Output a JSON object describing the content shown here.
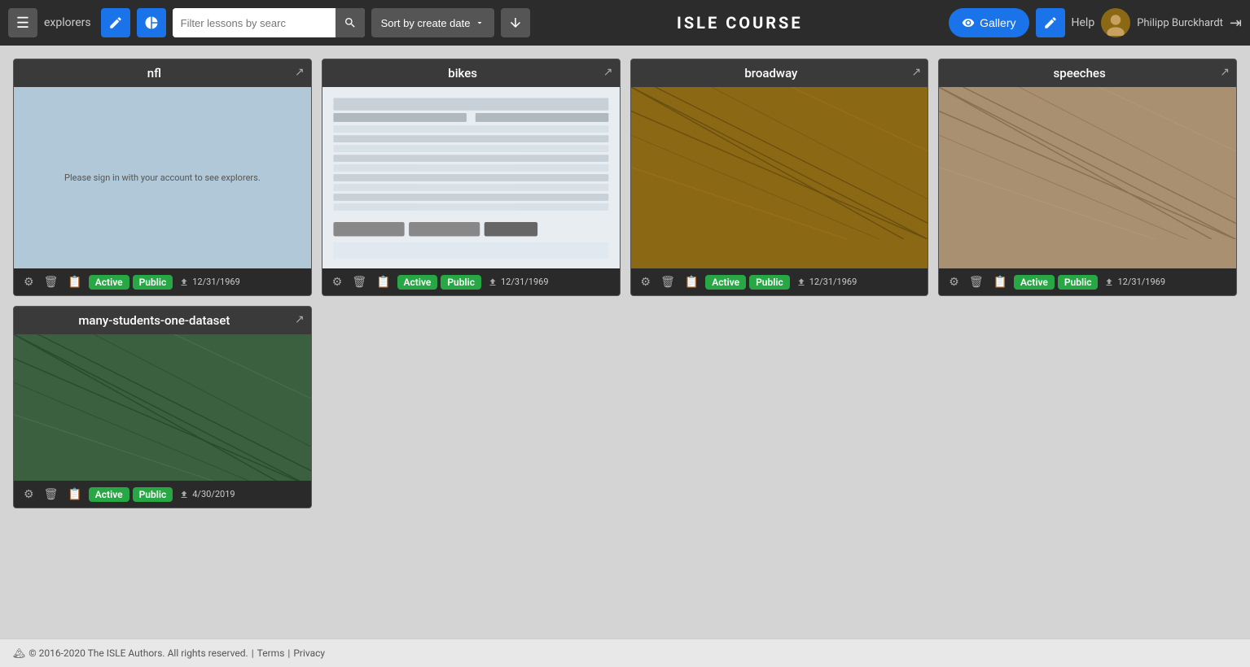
{
  "header": {
    "menu_icon": "☰",
    "explorers_label": "explorers",
    "search_placeholder": "Filter lessons by searc",
    "sort_label": "Sort by create date",
    "title": "ISLE  COURSE",
    "gallery_label": "Gallery",
    "help_label": "Help",
    "user_name": "Philipp Burckhardt"
  },
  "cards": [
    {
      "id": "nfl",
      "title": "nfl",
      "preview_type": "nfl",
      "sign_in_text": "Please sign in with your account to see explorers.",
      "badges": [
        "Active",
        "Public"
      ],
      "date": "12/31/1969"
    },
    {
      "id": "bikes",
      "title": "bikes",
      "preview_type": "bikes",
      "badges": [
        "Active",
        "Public"
      ],
      "date": "12/31/1969"
    },
    {
      "id": "broadway",
      "title": "broadway",
      "preview_type": "broadway",
      "badges": [
        "Active",
        "Public"
      ],
      "date": "12/31/1969"
    },
    {
      "id": "speeches",
      "title": "speeches",
      "preview_type": "speeches",
      "badges": [
        "Active",
        "Public"
      ],
      "date": "12/31/1969"
    }
  ],
  "cards_row2": [
    {
      "id": "many-students",
      "title": "many-students-one-dataset",
      "preview_type": "many",
      "badges": [
        "Active",
        "Public"
      ],
      "date": "4/30/2019"
    }
  ],
  "footer": {
    "copyright": "© 2016-2020 The ISLE Authors. All rights reserved.",
    "terms_label": "Terms",
    "privacy_label": "Privacy"
  }
}
